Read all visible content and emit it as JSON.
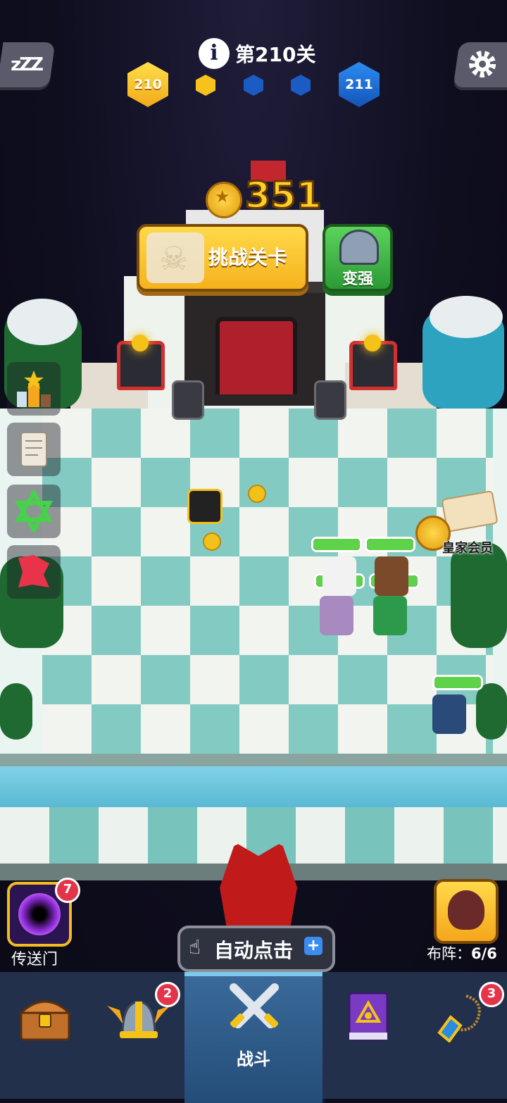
{
  "header": {
    "sleep_label": "zZZ",
    "level_title": "第210关",
    "current_level": "210",
    "next_level": "211",
    "progress_dots": [
      "done",
      "pending",
      "pending"
    ]
  },
  "challenge": {
    "coin_amount": "351",
    "button_label": "挑战关卡",
    "power_label": "变强"
  },
  "side_menu": [
    {
      "name": "ranking-icon"
    },
    {
      "name": "scroll-icon"
    },
    {
      "name": "hexagram-icon"
    },
    {
      "name": "red-arrow-icon"
    }
  ],
  "vip": {
    "label": "皇家会员"
  },
  "portal": {
    "label": "传送门",
    "badge": "7"
  },
  "auto_click": {
    "label": "自动点击",
    "plus": "+"
  },
  "formation": {
    "label": "布阵：",
    "count": "6/6"
  },
  "nav": {
    "tabs": [
      {
        "name": "chest",
        "badge": ""
      },
      {
        "name": "hero-helmet",
        "badge": "2"
      },
      {
        "name": "battle",
        "label": "战斗",
        "active": true
      },
      {
        "name": "spellbook",
        "badge": ""
      },
      {
        "name": "amulet",
        "badge": "3"
      }
    ]
  },
  "colors": {
    "gold": "#f5c218",
    "accent_blue": "#1a5bc4",
    "badge_red": "#e3344a",
    "hp_green": "#5ed34a"
  }
}
